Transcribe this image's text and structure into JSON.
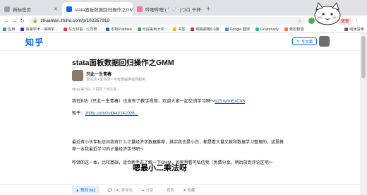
{
  "tabs": [
    {
      "label": "新标签页",
      "icon": "tab-page-icon",
      "color": "#9aa0a6"
    },
    {
      "label": "stata面板数据回归操作之GMM",
      "icon": "zhihu-favicon-icon",
      "color": "#0066ff"
    },
    {
      "label": "哔哩哔哩 ( ゜- ゜)つロ 干杯~-bili",
      "icon": "bilibili-favicon-icon",
      "color": "#fb7299"
    }
  ],
  "address": {
    "url": "zhuanlan.zhihu.com/p/102357919",
    "update_label": "更新"
  },
  "bookmarks": {
    "items": [
      {
        "label": "应用",
        "color": "#4285f4"
      },
      {
        "label": "百度学术 - 保持学...",
        "color": "#2932e1"
      },
      {
        "label": "东方财富 - 公司研...",
        "color": "#e53935"
      },
      {
        "label": "本地PubMed",
        "color": "#1565c0"
      },
      {
        "label": "欢迎来到大学...",
        "color": "#43a047"
      },
      {
        "label": "书签",
        "color": "#fbbc05"
      },
      {
        "label": "网易邮箱6.0版",
        "color": "#d32f2f"
      },
      {
        "label": "Google 翻译",
        "color": "#4285f4"
      },
      {
        "label": "Grammarly",
        "color": "#15c39a"
      },
      {
        "label": "我的智慧",
        "color": "#ff7043"
      }
    ],
    "reading_list": "阅读清单"
  },
  "zhihu": {
    "logo": "知乎",
    "write_label": "写文章"
  },
  "article": {
    "title": "stata面板数据回归操作之GMM",
    "author_name": "只此一生青春",
    "author_desc": "爱生活 • 爱科研 • 可有偿提供指导服务",
    "likes_line": "Ming 等 661 人赞同了该文章",
    "p1_text": "我在B站（只此一生青春）也发布了教学视频，欢迎大家一起交流学习呀～",
    "p1_link": "b23.tv/mEzCV5",
    "p2_prefix": "知乎：",
    "p2_link": "zhihu.com/zvideo/141026...",
    "p3": "最近有小伙伴私信问我有什么计量经济学数据推荐，其实我也是小白，都是看大量文献和数据学习整理的，这里推荐一本我最近学习的计量经济学书吧～",
    "p4": "咋领的这一本，比较基础，适合新手去了解一下GMM，如果想看可私信我（免费分享，稍后放到评论区吧～",
    "subtitle": "嗯最小二乘法呀"
  },
  "actions": {
    "vote": "▲ 赞同 661",
    "comments": "141 条评论",
    "share": "分享",
    "favorite": "喜欢",
    "collect": "收藏"
  },
  "colors": {
    "zhihu_blue": "#0066ff",
    "link": "#175199"
  }
}
